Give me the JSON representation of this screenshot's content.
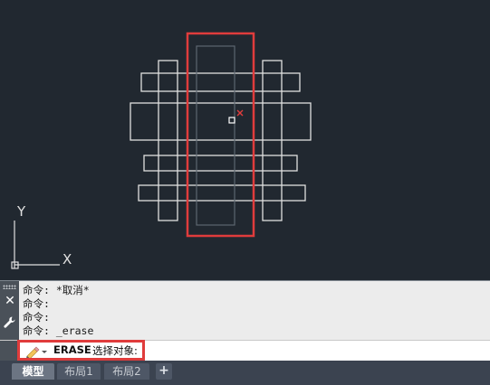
{
  "colors": {
    "canvas_bg": "#212830",
    "geometry": "#e0e0e0",
    "highlight": "#e03c3c",
    "panel_bg": "#ececec"
  },
  "ucs": {
    "x_label": "X",
    "y_label": "Y"
  },
  "command_history": [
    "命令: *取消*",
    "命令:",
    "命令:",
    "命令: _erase"
  ],
  "command_input": {
    "command_icon": "pencil-eraser-icon",
    "command_name": "ERASE",
    "prompt": "选择对象:"
  },
  "layout_tabs": [
    {
      "label": "模型",
      "active": true
    },
    {
      "label": "布局1",
      "active": false
    },
    {
      "label": "布局2",
      "active": false
    }
  ],
  "add_layout_label": "+",
  "close_label": "✕"
}
